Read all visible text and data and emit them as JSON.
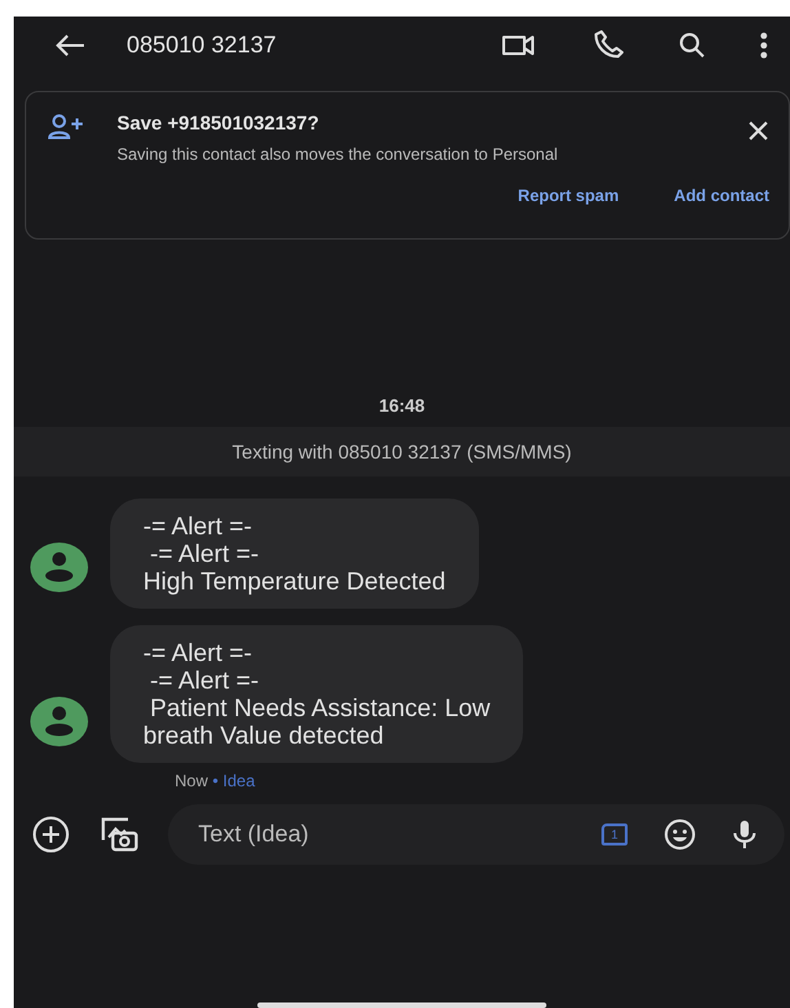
{
  "header": {
    "title": "085010 32137"
  },
  "save_banner": {
    "title": "Save +918501032137?",
    "text": "Saving this contact also moves the conversation to Personal",
    "actions": [
      "Report spam",
      "Add contact"
    ]
  },
  "timestamp": "16:48",
  "texting_notice": "Texting with 085010 32137 (SMS/MMS)",
  "messages": [
    {
      "lines": [
        "-= Alert =-",
        " -= Alert =-",
        "High Temperature Detected"
      ]
    },
    {
      "lines": [
        "-= Alert =-",
        " -= Alert =-",
        " Patient Needs Assistance: Low",
        "breath Value detected"
      ]
    }
  ],
  "message_status": {
    "time": "Now",
    "carrier": "• Idea"
  },
  "composer": {
    "placeholder": "Text (Idea)",
    "sim": "1"
  }
}
